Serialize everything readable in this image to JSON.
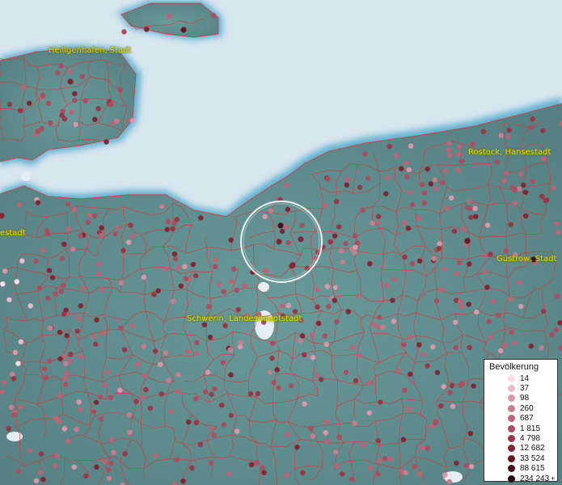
{
  "map": {
    "city_labels": [
      "Heiligenhafen, Stadt",
      "Rostock, Hansestadt",
      "Güstrow, Stadt",
      "Schwerin, Landeshauptstadt",
      "estadt"
    ],
    "colors": {
      "sea": "#d8e6ee",
      "land": "#5e8c8e",
      "boundary": "#d43a3a",
      "label": "#e8e000",
      "highlight_ring": "#ffffff"
    }
  },
  "legend": {
    "title": "Bevölkerung",
    "entries": [
      {
        "label": "14",
        "color": "#f6dfe6"
      },
      {
        "label": "37",
        "color": "#e9bccb"
      },
      {
        "label": "98",
        "color": "#d89aaa"
      },
      {
        "label": "260",
        "color": "#c67f90"
      },
      {
        "label": "687",
        "color": "#b96577"
      },
      {
        "label": "1 815",
        "color": "#a94d60"
      },
      {
        "label": "4 798",
        "color": "#953849"
      },
      {
        "label": "12 682",
        "color": "#7e2836"
      },
      {
        "label": "33 524",
        "color": "#641a26"
      },
      {
        "label": "88 615",
        "color": "#471019"
      },
      {
        "label": "234 243",
        "color": "#2a070c"
      }
    ],
    "overflow_symbol": "+"
  }
}
